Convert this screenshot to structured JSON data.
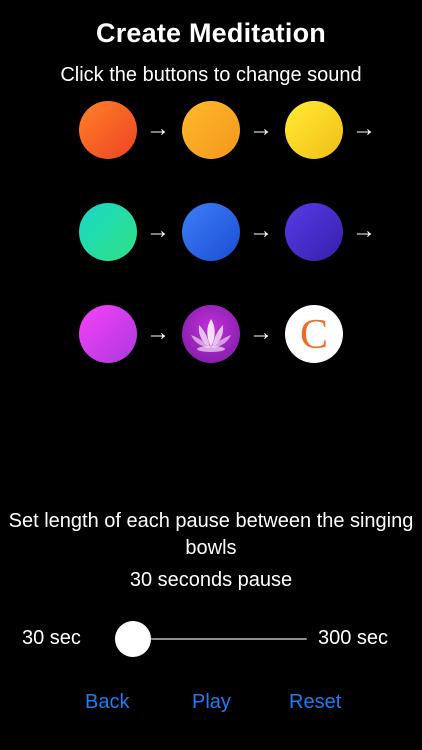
{
  "header": {
    "title": "Create Meditation",
    "subtitle": "Click the buttons to change sound"
  },
  "bowls": [
    {
      "name": "bowl-red-orange-button",
      "colors": [
        "#ff7a28",
        "#ee4a22"
      ],
      "arrow": "→"
    },
    {
      "name": "bowl-orange-button",
      "colors": [
        "#ffb62a",
        "#f59a1e"
      ],
      "arrow": "→"
    },
    {
      "name": "bowl-yellow-button",
      "colors": [
        "#ffe830",
        "#f2c21a"
      ],
      "arrow": "→"
    },
    {
      "name": "bowl-teal-button",
      "colors": [
        "#1ad9c1",
        "#2ee08a"
      ],
      "arrow": "→"
    },
    {
      "name": "bowl-blue-button",
      "colors": [
        "#3a7af5",
        "#1f52d6"
      ],
      "arrow": "→"
    },
    {
      "name": "bowl-indigo-button",
      "colors": [
        "#5438e2",
        "#3a22b0"
      ],
      "arrow": "→"
    },
    {
      "name": "bowl-magenta-button",
      "colors": [
        "#f040f5",
        "#b23ae0"
      ],
      "arrow": "→"
    },
    {
      "name": "bowl-lotus-button",
      "icon": "lotus-icon",
      "colors": [
        "#c030d8",
        "#8a1fb0"
      ],
      "arrow": "→"
    },
    {
      "name": "bowl-c-logo-button",
      "icon": "c-logo-icon",
      "letter": "C",
      "colors": [
        "#ffffff",
        "#ffffff"
      ],
      "letter_color": "#e8702a"
    }
  ],
  "pause": {
    "description": "Set length of each pause between the singing bowls",
    "value_label": "30 seconds pause",
    "min_label": "30 sec",
    "max_label": "300 sec",
    "min": 30,
    "max": 300,
    "value": 30
  },
  "footer": {
    "back": "Back",
    "play": "Play",
    "reset": "Reset"
  },
  "colors": {
    "accent": "#1e7cf5",
    "background": "#000000"
  }
}
